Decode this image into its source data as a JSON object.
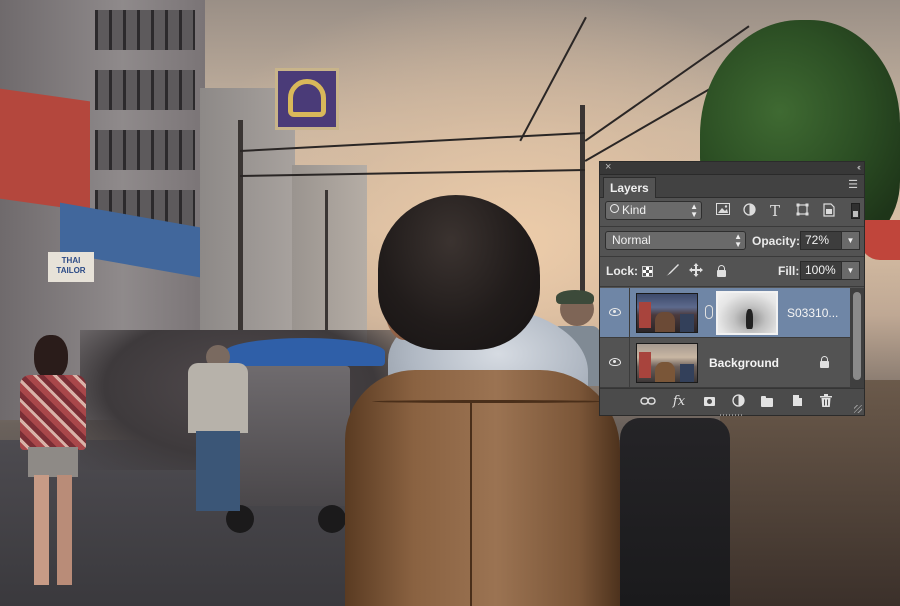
{
  "photo": {
    "shop_sign_text": "THAI\nTAILOR"
  },
  "layers_panel": {
    "title_close": "×",
    "title_collapse": "‹‹",
    "tab_label": "Layers",
    "tab_menu_icon": "panel-menu-icon",
    "filter": {
      "selected": "Kind",
      "icons": [
        "image-filter-icon",
        "adjustment-filter-icon",
        "type-filter-icon",
        "shape-filter-icon",
        "smart-object-filter-icon"
      ],
      "type_glyph": "T"
    },
    "blend_mode": "Normal",
    "opacity_label": "Opacity:",
    "opacity_value": "72%",
    "lock_label": "Lock:",
    "fill_label": "Fill:",
    "fill_value": "100%",
    "layers": [
      {
        "name": "S03310...",
        "visible": true,
        "selected": true,
        "has_mask": true,
        "locked": false
      },
      {
        "name": "Background",
        "visible": true,
        "selected": false,
        "has_mask": false,
        "locked": true
      }
    ],
    "bottom_bar": {
      "fx_label": "fx",
      "icons": [
        "link-layers-icon",
        "layer-style-icon",
        "add-mask-icon",
        "adjustment-layer-icon",
        "new-group-icon",
        "new-layer-icon",
        "trash-icon"
      ]
    },
    "colors": {
      "panel_bg": "#535353",
      "selected_row": "#6f86a6",
      "text": "#f4f4f4"
    }
  }
}
